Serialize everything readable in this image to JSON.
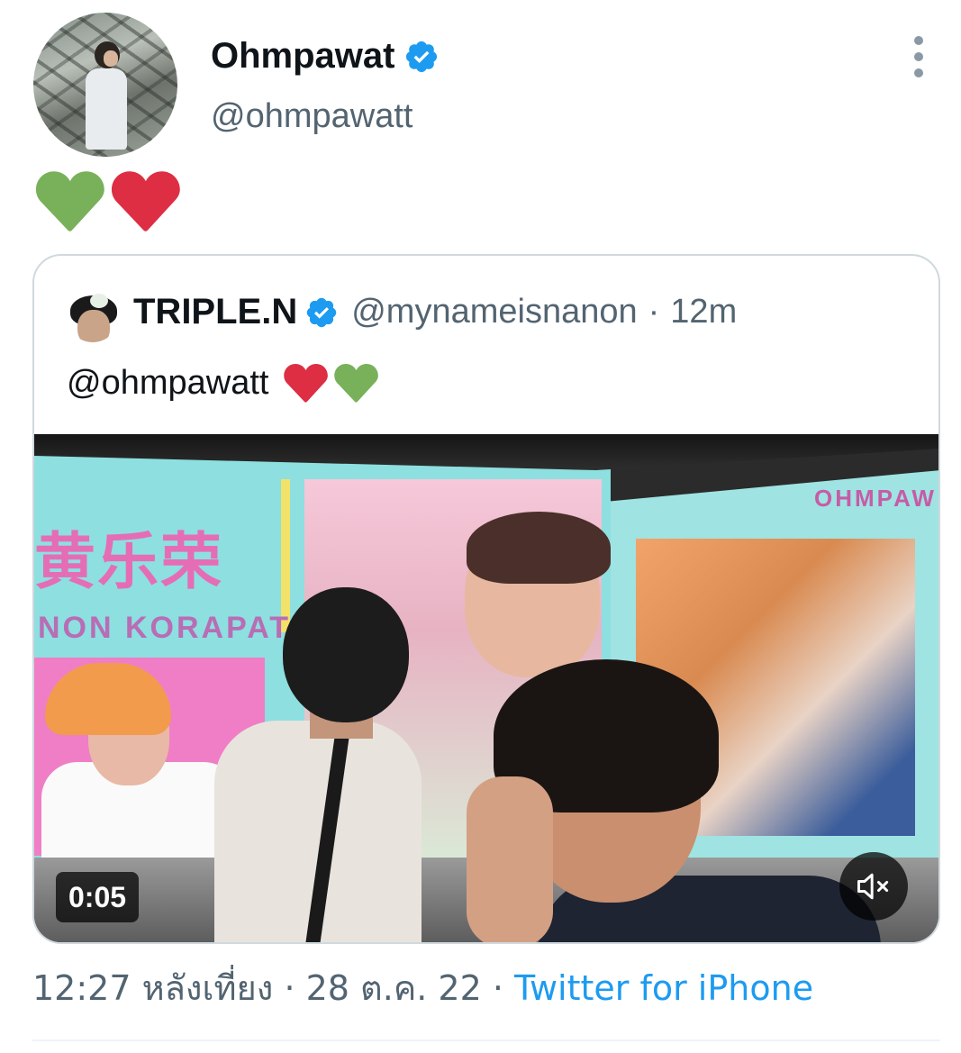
{
  "tweet": {
    "author": {
      "name": "Ohmpawat",
      "handle": "@ohmpawatt",
      "verified": true,
      "avatar_icon": "profile-photo"
    },
    "text_emojis": [
      "green-heart",
      "red-heart"
    ],
    "more_icon": "more-vertical-icon",
    "quote": {
      "author_name": "TRIPLE.N",
      "verified": true,
      "handle": "@mynameisnanon",
      "separator": "·",
      "time": "12m",
      "mention": "@ohmpawatt",
      "text_emojis": [
        "red-heart",
        "green-heart"
      ],
      "media": {
        "type": "video",
        "duration": "0:05",
        "mute_icon": "volume-muted-icon",
        "screen_text": [
          "黄乐荣",
          "NON KORAPAT",
          "OHMPAW"
        ]
      }
    },
    "timestamp": {
      "time": "12:27 หลังเที่ยง",
      "separator1": "·",
      "date": "28 ต.ค. 22",
      "separator2": "·",
      "source": "Twitter for iPhone"
    }
  },
  "colors": {
    "text_primary": "#0f1419",
    "text_secondary": "#536471",
    "link": "#1d9bf0",
    "verified": "#1d9bf0",
    "border": "#cfd9de",
    "green_heart": "#78b159",
    "red_heart": "#dd2e44"
  }
}
